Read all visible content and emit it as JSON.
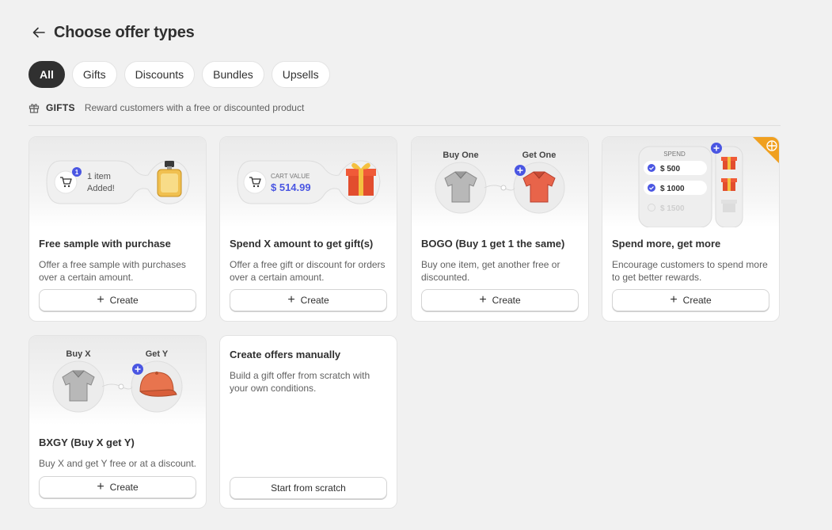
{
  "header": {
    "title": "Choose offer types"
  },
  "tabs": [
    {
      "label": "All",
      "active": true
    },
    {
      "label": "Gifts",
      "active": false
    },
    {
      "label": "Discounts",
      "active": false
    },
    {
      "label": "Bundles",
      "active": false
    },
    {
      "label": "Upsells",
      "active": false
    }
  ],
  "section": {
    "title": "GIFTS",
    "description": "Reward customers with a free or discounted product"
  },
  "cards": [
    {
      "title": "Free sample with purchase",
      "description": "Offer a free sample with purchases over a certain amount.",
      "button": "Create",
      "illustration": {
        "badge": "1",
        "line1": "1 item",
        "line2": "Added!"
      }
    },
    {
      "title": "Spend X amount to get gift(s)",
      "description": "Offer a free gift or discount for orders over a certain amount.",
      "button": "Create",
      "illustration": {
        "label": "CART VALUE",
        "value": "$ 514.99"
      }
    },
    {
      "title": "BOGO (Buy 1 get 1 the same)",
      "description": "Buy one item, get another free or discounted.",
      "button": "Create",
      "illustration": {
        "left": "Buy One",
        "right": "Get One"
      }
    },
    {
      "title": "Spend more, get more",
      "description": "Encourage customers to spend more to get better rewards.",
      "button": "Create",
      "illustration": {
        "label": "SPEND",
        "tier1": "$ 500",
        "tier2": "$ 1000",
        "tier3": "$ 1500"
      }
    },
    {
      "title": "BXGY (Buy X get Y)",
      "description": "Buy X and get Y free or at a discount.",
      "button": "Create",
      "illustration": {
        "left": "Buy X",
        "right": "Get Y"
      }
    }
  ],
  "manual": {
    "title": "Create offers manually",
    "description": "Build a gift offer from scratch with your own conditions.",
    "button": "Start from scratch"
  },
  "colors": {
    "accent": "#4a56e2",
    "active_tab": "#303030",
    "shirt": "#e8644a",
    "cap": "#e8744e",
    "ribbon": "#f0a020"
  },
  "icons": [
    "back-arrow-icon",
    "gift-icon",
    "cart-icon",
    "plus-icon",
    "perfume-bottle-icon",
    "gift-box-icon",
    "shirt-icon",
    "cap-icon",
    "check-icon",
    "sparkle-icon"
  ]
}
